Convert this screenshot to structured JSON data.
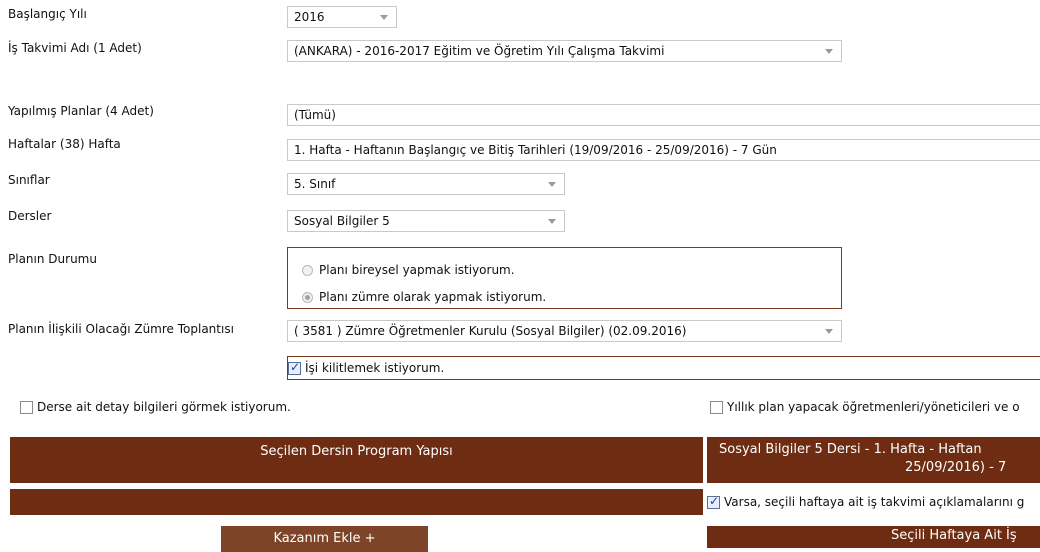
{
  "form": {
    "start_year": {
      "label": "Başlangıç Yılı",
      "value": "2016"
    },
    "calendar": {
      "label": "İş Takvimi Adı (1 Adet)",
      "value": "(ANKARA) - 2016-2017 Eğitim ve Öğretim Yılı Çalışma Takvimi"
    },
    "plans": {
      "label": "Yapılmış Planlar (4 Adet)",
      "value": "(Tümü)"
    },
    "weeks": {
      "label": "Haftalar (38) Hafta",
      "value": "1. Hafta - Haftanın Başlangıç ve Bitiş Tarihleri (19/09/2016 - 25/09/2016) - 7 Gün"
    },
    "classes": {
      "label": "Sınıflar",
      "value": "5. Sınıf"
    },
    "lessons": {
      "label": "Dersler",
      "value": "Sosyal Bilgiler 5"
    },
    "plan_status": {
      "label": "Planın Durumu",
      "options": [
        "Planı bireysel yapmak istiyorum.",
        "Planı zümre olarak yapmak istiyorum."
      ],
      "selected_index": 1
    },
    "meeting": {
      "label": "Planın İlişkili Olacağı Zümre Toplantısı",
      "value": "( 3581 ) Zümre Öğretmenler Kurulu (Sosyal Bilgiler) (02.09.2016)"
    },
    "lock": {
      "label": "İşi kilitlemek istiyorum.",
      "checked": true
    }
  },
  "options": {
    "detail_checkbox": {
      "label": "Derse ait detay bilgileri görmek istiyorum.",
      "checked": false
    },
    "teachers_checkbox": {
      "label": "Yıllık plan yapacak öğretmenleri/yöneticileri ve o",
      "checked": false
    }
  },
  "panels": {
    "left_title": "Seçilen Dersin Program Yapısı",
    "right_title_line1": "Sosyal Bilgiler 5 Dersi - 1. Hafta - Haftan",
    "right_title_line2": "25/09/2016) - 7",
    "right_checkbox": {
      "label": "Varsa, seçili haftaya ait iş takvimi açıklamalarını g",
      "checked": true
    },
    "add_button": "Kazanım Ekle +",
    "right_bottom_title": "Seçili Haftaya Ait İş"
  },
  "colors": {
    "brown": "#6e2d12",
    "button_brown": "#7d4428",
    "border_brown": "#7a3a1c"
  }
}
